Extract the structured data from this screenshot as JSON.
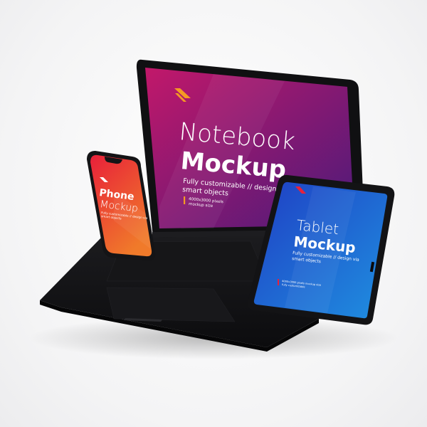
{
  "colors": {
    "notebook_screen_from": "#c2186a",
    "notebook_screen_to": "#4a1a7a",
    "phone_screen_from": "#e8203a",
    "phone_screen_to": "#f07a2a",
    "tablet_screen_from": "#1f3fc4",
    "tablet_screen_to": "#1f8fe0",
    "accent_orange": "#f59a23",
    "accent_red": "#e8213c",
    "device_body": "#151517"
  },
  "notebook": {
    "title_light": "Notebook",
    "title_bold": "Mockup",
    "desc_line1": "Fully customizable // design via",
    "desc_line2": "smart objects",
    "spec_line1": "4000x3000 pixels",
    "spec_line2": "mockup size"
  },
  "phone": {
    "title_bold": "Phone",
    "title_light": "Mockup",
    "desc_line1": "Fully customizable // design via",
    "desc_line2": "smart objects"
  },
  "tablet": {
    "title_light": "Tablet",
    "title_bold": "Mockup",
    "desc_line1": "Fully customizable // design via",
    "desc_line2": "smart objects",
    "spec_line1": "4000x3000 pixels mockup size",
    "spec_line2": "fully customizable"
  }
}
